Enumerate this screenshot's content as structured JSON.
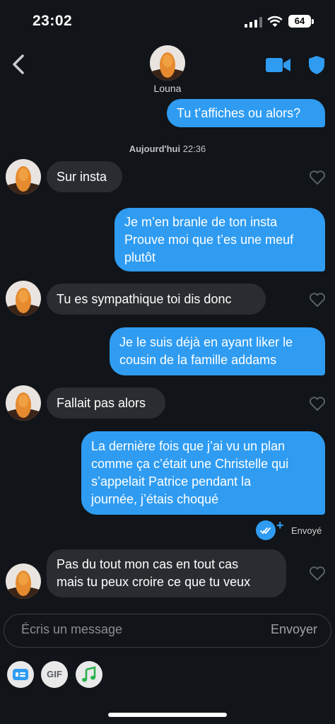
{
  "status_bar": {
    "time": "23:02",
    "battery": "64"
  },
  "header": {
    "name": "Louna"
  },
  "messages": {
    "m1": "Tu t’affiches ou alors?",
    "date_day": "Aujourd'hui",
    "date_time": " 22:36",
    "m2": "Sur insta",
    "m3": "Je m’en branle de ton insta\nProuve moi que t’es une meuf\nplutôt",
    "m4": "Tu es sympathique toi dis donc",
    "m5": "Je le suis déjà en ayant liker le\ncousin de la famille addams",
    "m6": "Fallait pas alors",
    "m7": "La dernière fois que j’ai vu un plan\ncomme ça c’était une Christelle qui\ns’appelait Patrice pendant la\njournée, j’étais choqué",
    "sent_status": "Envoyé",
    "m8": "Pas du tout mon cas en tout cas\nmais tu peux croire ce que tu veux"
  },
  "composer": {
    "placeholder": "Écris un message",
    "send_label": "Envoyer",
    "gif_label": "GIF"
  },
  "icons": {
    "back": "chevron-left-icon",
    "video": "video-camera-icon",
    "shield": "shield-icon",
    "heart": "heart-outline-icon",
    "sent": "double-check-icon",
    "sticker": "sticker-card-icon",
    "music": "music-note-icon"
  },
  "colors": {
    "background": "#111418",
    "outgoing_bubble": "#2f9cf2",
    "incoming_bubble": "#2a2c31",
    "accent": "#2f9cf2",
    "music_icon": "#2bb24c"
  }
}
